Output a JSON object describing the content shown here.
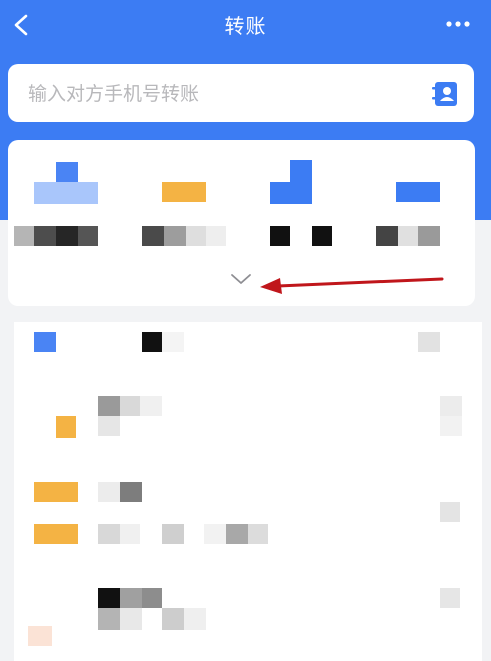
{
  "header": {
    "title": "转账",
    "accent": "#3c7cf3"
  },
  "search": {
    "placeholder": "输入对方手机号转账"
  },
  "icons": {
    "back": "chevron-left-icon",
    "more": "more-horizontal-icon",
    "contact": "contact-book-icon",
    "expand": "chevron-down-icon"
  },
  "annotation": {
    "color": "#c0161b"
  }
}
